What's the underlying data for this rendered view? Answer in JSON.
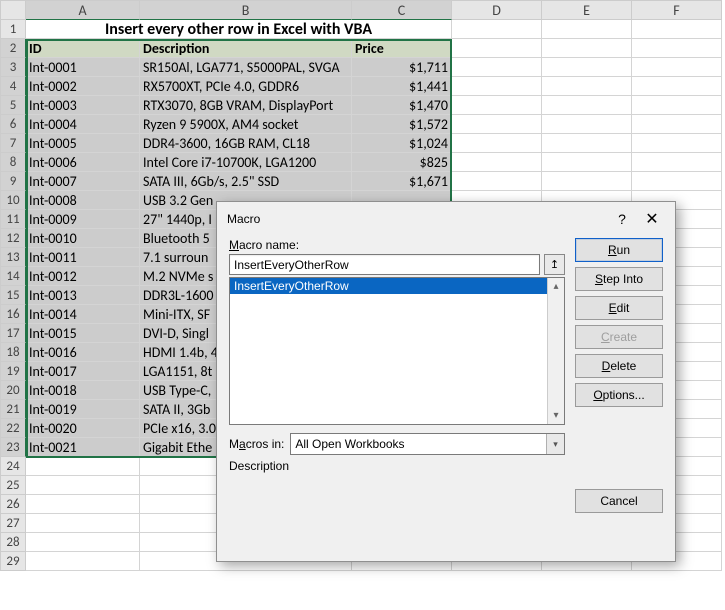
{
  "columns": [
    "A",
    "B",
    "C",
    "D",
    "E",
    "F"
  ],
  "title": "Insert every other row in Excel with VBA",
  "headers": {
    "id": "ID",
    "desc": "Description",
    "price": "Price"
  },
  "rows": [
    {
      "id": "Int-0001",
      "desc": "SR150Al, LGA771, S5000PAL, SVGA",
      "price": "$1,711"
    },
    {
      "id": "Int-0002",
      "desc": "RX5700XT, PCIe 4.0, GDDR6",
      "price": "$1,441"
    },
    {
      "id": "Int-0003",
      "desc": "RTX3070, 8GB VRAM, DisplayPort",
      "price": "$1,470"
    },
    {
      "id": "Int-0004",
      "desc": "Ryzen 9 5900X, AM4 socket",
      "price": "$1,572"
    },
    {
      "id": "Int-0005",
      "desc": "DDR4-3600, 16GB RAM, CL18",
      "price": "$1,024"
    },
    {
      "id": "Int-0006",
      "desc": "Intel Core i7-10700K, LGA1200",
      "price": "$825"
    },
    {
      "id": "Int-0007",
      "desc": "SATA III, 6Gb/s, 2.5\" SSD",
      "price": "$1,671"
    },
    {
      "id": "Int-0008",
      "desc": "USB 3.2 Gen",
      "price": ""
    },
    {
      "id": "Int-0009",
      "desc": "27\" 1440p, I",
      "price": ""
    },
    {
      "id": "Int-0010",
      "desc": "Bluetooth 5",
      "price": ""
    },
    {
      "id": "Int-0011",
      "desc": "7.1 surroun",
      "price": ""
    },
    {
      "id": "Int-0012",
      "desc": "M.2 NVMe s",
      "price": ""
    },
    {
      "id": "Int-0013",
      "desc": "DDR3L-1600",
      "price": ""
    },
    {
      "id": "Int-0014",
      "desc": "Mini-ITX, SF",
      "price": ""
    },
    {
      "id": "Int-0015",
      "desc": "DVI-D, Singl",
      "price": ""
    },
    {
      "id": "Int-0016",
      "desc": "HDMI 1.4b, 4",
      "price": ""
    },
    {
      "id": "Int-0017",
      "desc": "LGA1151, 8t",
      "price": ""
    },
    {
      "id": "Int-0018",
      "desc": "USB Type-C,",
      "price": ""
    },
    {
      "id": "Int-0019",
      "desc": "SATA II, 3Gb",
      "price": ""
    },
    {
      "id": "Int-0020",
      "desc": "PCIe x16, 3.0",
      "price": ""
    },
    {
      "id": "Int-0021",
      "desc": "Gigabit Ethe",
      "price": ""
    }
  ],
  "dialog": {
    "title": "Macro",
    "macro_name_label": "Macro name:",
    "macro_name_value": "InsertEveryOtherRow",
    "list_item": "InsertEveryOtherRow",
    "macros_in_label": "Macros in:",
    "macros_in_value": "All Open Workbooks",
    "description_label": "Description",
    "buttons": {
      "run": "Run",
      "step": "Step Into",
      "edit": "Edit",
      "create": "Create",
      "delete": "Delete",
      "options": "Options...",
      "cancel": "Cancel"
    }
  }
}
